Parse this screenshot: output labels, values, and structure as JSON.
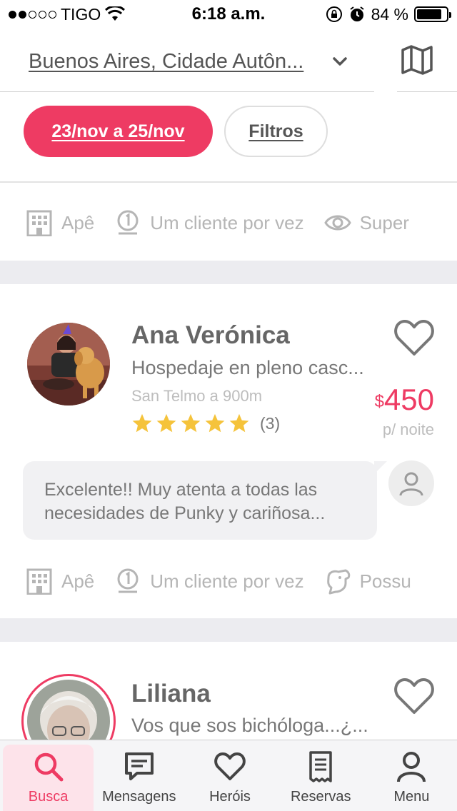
{
  "status_bar": {
    "carrier": "TIGO",
    "time": "6:18 a.m.",
    "battery": "84 %",
    "battery_level": 0.84
  },
  "header": {
    "location": "Buenos Aires, Cidade Autôn...",
    "map_icon": "map-icon",
    "chevron_icon": "chevron-down-icon"
  },
  "filters": {
    "dates": "23/nov a 25/nov",
    "filters_label": "Filtros"
  },
  "top_features": [
    {
      "icon": "building-icon",
      "label": "Apê"
    },
    {
      "icon": "one-client-icon",
      "label": "Um cliente por vez"
    },
    {
      "icon": "eye-icon",
      "label": "Super"
    }
  ],
  "listings": [
    {
      "name": "Ana Verónica",
      "description": "Hospedaje en pleno casc...",
      "location": "San Telmo a 900m",
      "rating": 5,
      "reviews": "(3)",
      "currency": "$",
      "price": "450",
      "per": "p/ noite",
      "review_text_1": "Excelente!! Muy atenta a todas las",
      "review_text_2": "necesidades de Punky y cariñosa...",
      "features": [
        {
          "icon": "building-icon",
          "label": "Apê"
        },
        {
          "icon": "one-client-icon",
          "label": "Um cliente por vez"
        },
        {
          "icon": "dog-icon",
          "label": "Possu"
        }
      ]
    },
    {
      "name": "Liliana",
      "description": "Vos que sos bichóloga...¿..."
    }
  ],
  "tabs": [
    {
      "label": "Busca",
      "icon": "search-icon",
      "active": true
    },
    {
      "label": "Mensagens",
      "icon": "message-icon"
    },
    {
      "label": "Heróis",
      "icon": "heart-icon"
    },
    {
      "label": "Reservas",
      "icon": "receipt-icon"
    },
    {
      "label": "Menu",
      "icon": "user-icon"
    }
  ],
  "colors": {
    "accent": "#ee3b63",
    "star": "#f5c33b",
    "muted": "#b5b5b5"
  }
}
